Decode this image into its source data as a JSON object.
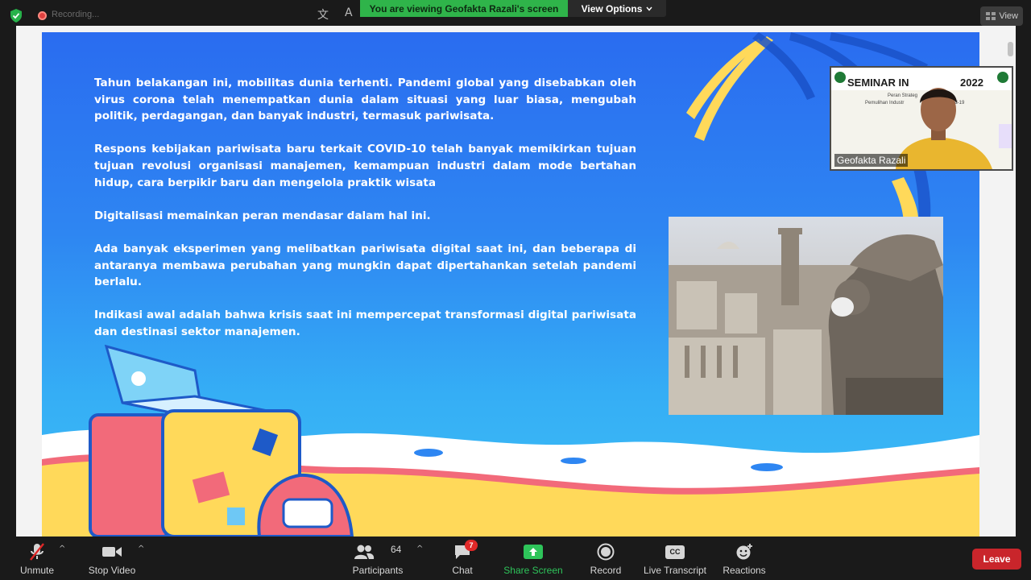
{
  "topbar": {
    "recording_label": "Recording...",
    "banner": "You are viewing Geofakta Razali's screen",
    "view_options": "View Options",
    "view_button": "View"
  },
  "slide": {
    "paragraphs": [
      "Tahun belakangan ini,  mobilitas dunia terhenti. Pandemi global yang disebabkan oleh virus corona telah menempatkan dunia dalam situasi yang luar biasa, mengubah politik, perdagangan, dan banyak industri, termasuk pariwisata.",
      "Respons kebijakan pariwisata baru terkait COVID-10 telah banyak memikirkan tujuan tujuan revolusi organisasi manajemen, kemampuan industri dalam mode bertahan hidup, cara berpikir baru dan mengelola praktik wisata",
      "Digitalisasi memainkan peran mendasar dalam hal ini.",
      "Ada banyak eksperimen yang melibatkan pariwisata digital saat ini, dan beberapa di antaranya membawa perubahan yang mungkin dapat dipertahankan setelah pandemi berlalu.",
      "Indikasi awal adalah bahwa krisis saat ini mempercepat transformasi digital pariwisata dan destinasi sektor manajemen."
    ]
  },
  "video": {
    "participant_name": "Geofakta Razali",
    "background_banner": "SEMINAR IN",
    "background_year": "2022",
    "background_subtitle_1": "Peran Strateg",
    "background_subtitle_2": "Pemulihan Industr",
    "background_subtitle_3": "rid-19"
  },
  "toolbar": {
    "unmute": "Unmute",
    "stop_video": "Stop Video",
    "participants": "Participants",
    "participants_count": "64",
    "chat": "Chat",
    "chat_badge": "7",
    "share_screen": "Share Screen",
    "record": "Record",
    "live_transcript": "Live Transcript",
    "cc": "CC",
    "reactions": "Reactions",
    "leave": "Leave"
  },
  "colors": {
    "accent_green": "#2ec45a",
    "leave_red": "#c9252b",
    "slide_blue": "#2e86f2"
  }
}
